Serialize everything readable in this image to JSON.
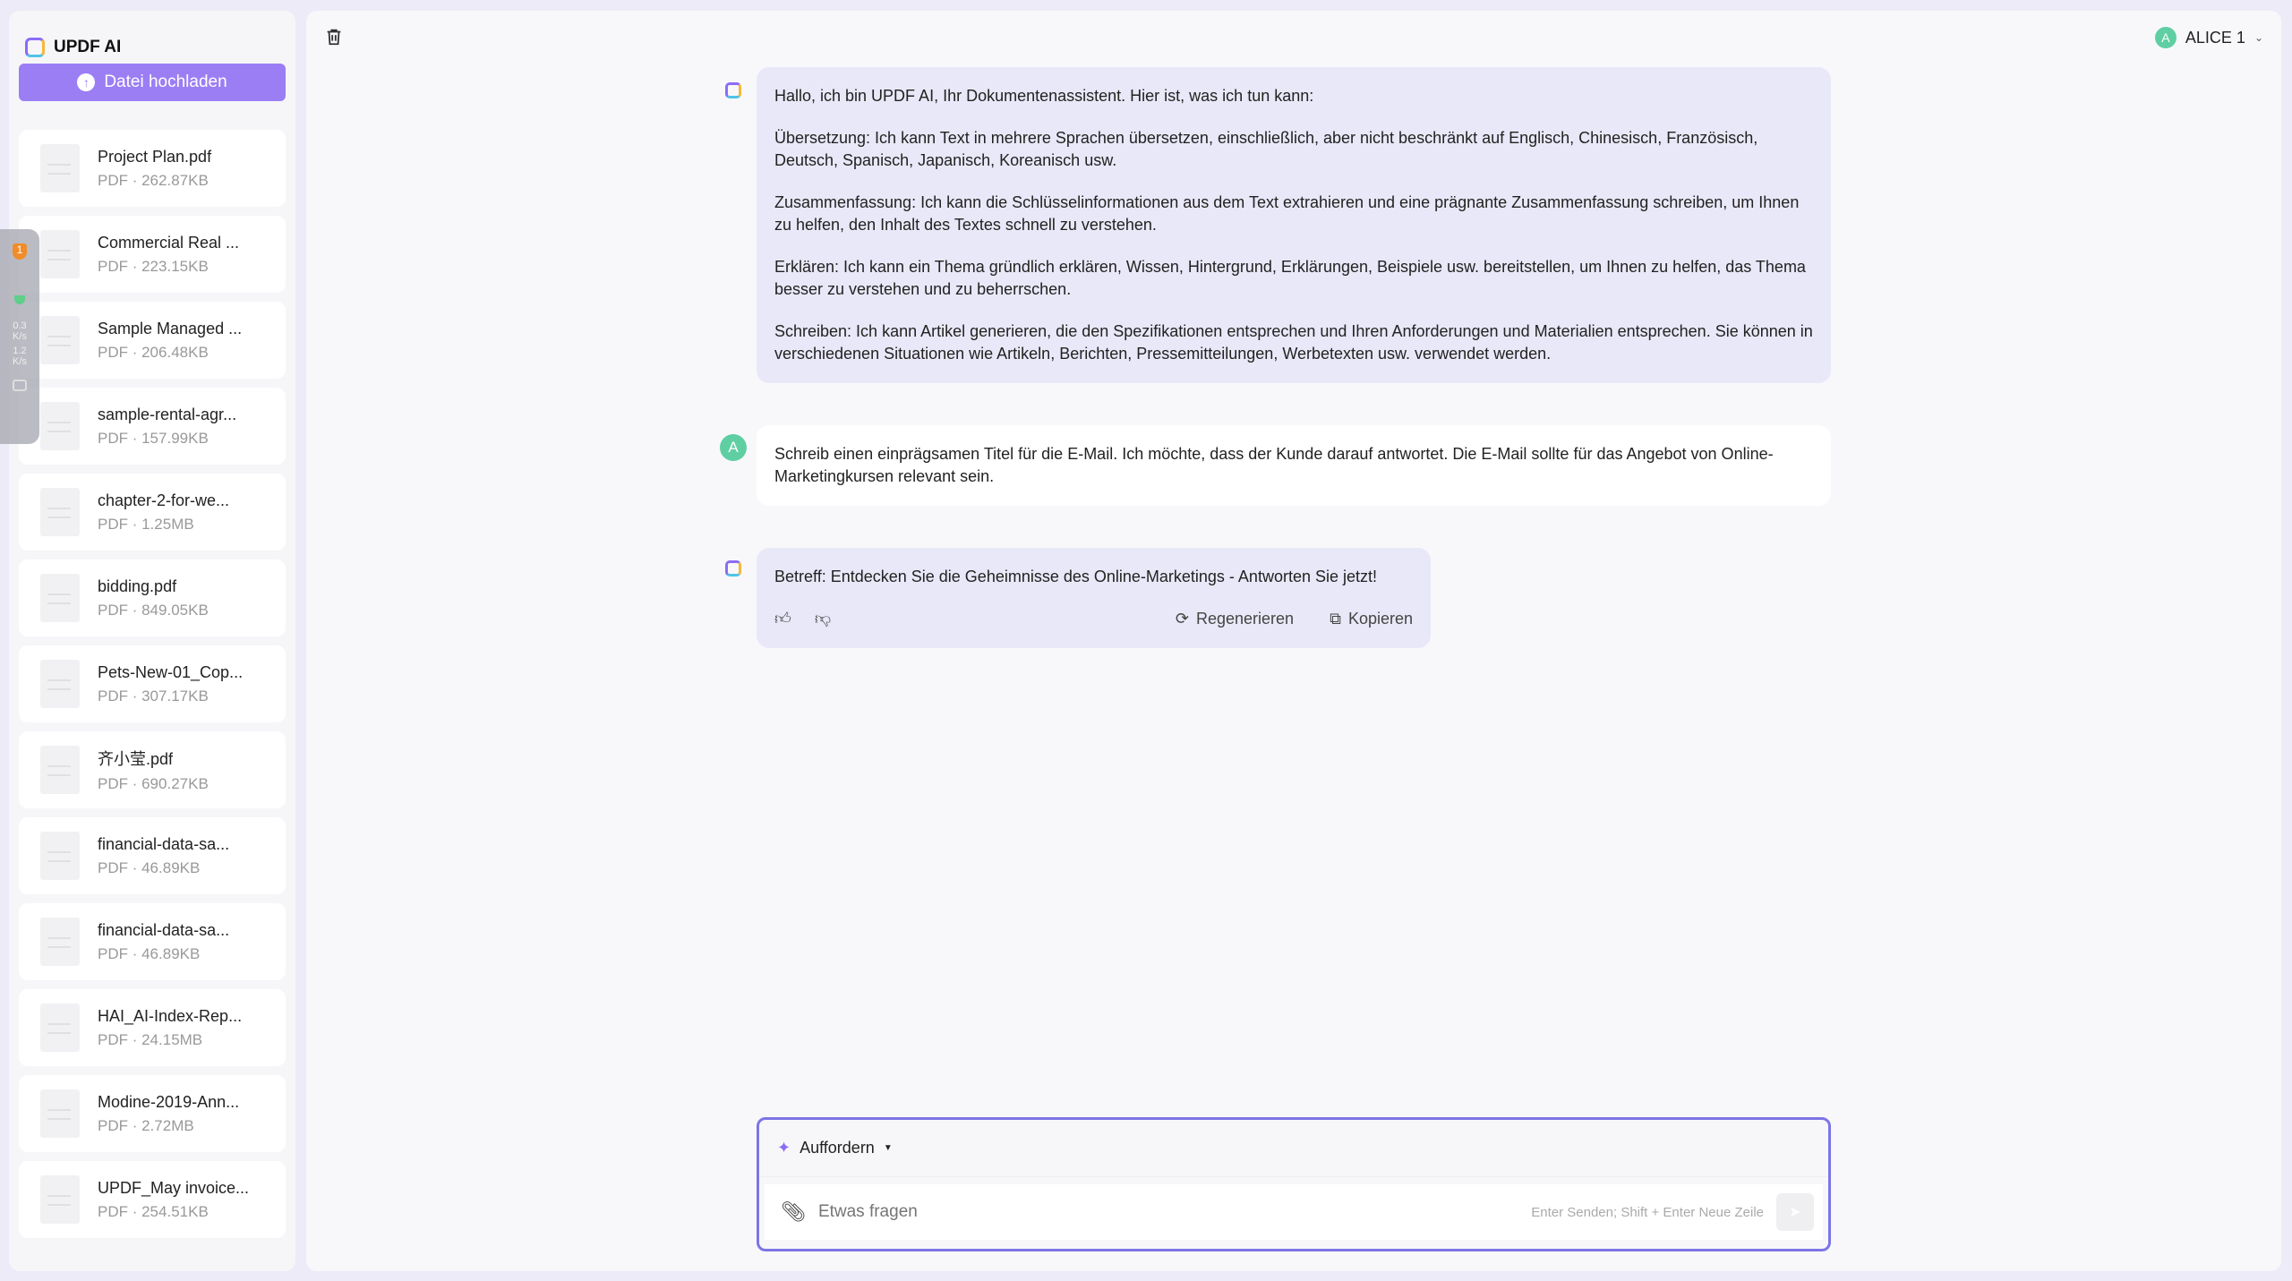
{
  "sidebar": {
    "title": "UPDF AI",
    "upload_label": "Datei hochladen",
    "files": [
      {
        "name": "Project Plan.pdf",
        "meta": "PDF · 262.87KB"
      },
      {
        "name": "Commercial Real ...",
        "meta": "PDF · 223.15KB"
      },
      {
        "name": "Sample Managed ...",
        "meta": "PDF · 206.48KB"
      },
      {
        "name": "sample-rental-agr...",
        "meta": "PDF · 157.99KB"
      },
      {
        "name": "chapter-2-for-we...",
        "meta": "PDF · 1.25MB"
      },
      {
        "name": "bidding.pdf",
        "meta": "PDF · 849.05KB"
      },
      {
        "name": "Pets-New-01_Cop...",
        "meta": "PDF · 307.17KB"
      },
      {
        "name": "齐小莹.pdf",
        "meta": "PDF · 690.27KB"
      },
      {
        "name": "financial-data-sa...",
        "meta": "PDF · 46.89KB"
      },
      {
        "name": "financial-data-sa...",
        "meta": "PDF · 46.89KB"
      },
      {
        "name": "HAI_AI-Index-Rep...",
        "meta": "PDF · 24.15MB"
      },
      {
        "name": "Modine-2019-Ann...",
        "meta": "PDF · 2.72MB"
      },
      {
        "name": "UPDF_May invoice...",
        "meta": "PDF · 254.51KB"
      }
    ]
  },
  "widget": {
    "badge": "1",
    "up": "0.3",
    "up_unit": "K/s",
    "down": "1.2",
    "down_unit": "K/s"
  },
  "header": {
    "user": "ALICE 1",
    "avatar": "A"
  },
  "messages": {
    "intro": [
      "Hallo, ich bin UPDF AI, Ihr Dokumentenassistent. Hier ist, was ich tun kann:",
      "Übersetzung: Ich kann Text in mehrere Sprachen übersetzen, einschließlich, aber nicht beschränkt auf Englisch, Chinesisch, Französisch, Deutsch, Spanisch, Japanisch, Koreanisch usw.",
      "Zusammenfassung: Ich kann die Schlüsselinformationen aus dem Text extrahieren und eine prägnante Zusammenfassung schreiben, um Ihnen zu helfen, den Inhalt des Textes schnell zu verstehen.",
      "Erklären: Ich kann ein Thema gründlich erklären, Wissen, Hintergrund, Erklärungen, Beispiele usw. bereitstellen, um Ihnen zu helfen, das Thema besser zu verstehen und zu beherrschen.",
      "Schreiben: Ich kann Artikel generieren, die den Spezifikationen entsprechen und Ihren Anforderungen und Materialien entsprechen. Sie können in verschiedenen Situationen wie Artikeln, Berichten, Pressemitteilungen, Werbetexten usw. verwendet werden."
    ],
    "user": "Schreib einen einprägsamen Titel für die E-Mail. Ich möchte, dass der Kunde darauf antwortet. Die E-Mail sollte für das Angebot von Online-Marketingkursen relevant sein.",
    "reply": "Betreff: Entdecken Sie die Geheimnisse des Online-Marketings - Antworten Sie jetzt!",
    "regenerate": "Regenerieren",
    "copy": "Kopieren"
  },
  "composer": {
    "mode": "Auffordern",
    "placeholder": "Etwas fragen",
    "hint": "Enter Senden; Shift + Enter Neue Zeile"
  }
}
